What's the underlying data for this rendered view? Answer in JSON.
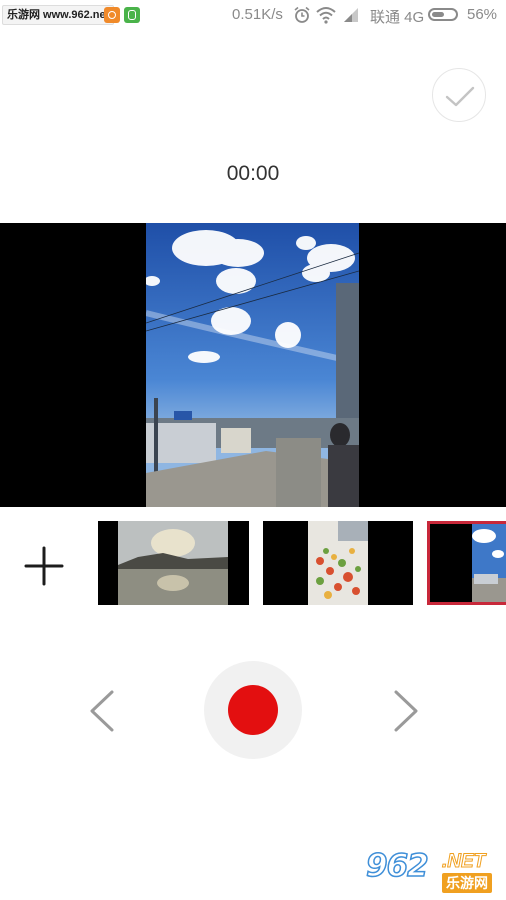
{
  "status_bar": {
    "watermark_label": "乐游网 www.962.net",
    "net_speed": "0.51K/s",
    "carrier": "联通 4G",
    "battery_percent": "56%",
    "battery_level": 0.56,
    "icons": [
      "app-notification-icon",
      "wechat-notification-icon",
      "alarm-clock-icon",
      "wifi-icon",
      "signal-icon",
      "battery-icon"
    ]
  },
  "toolbar": {
    "confirm_icon": "checkmark-icon"
  },
  "timer": "00:00",
  "preview": {
    "description_icon": "video-preview"
  },
  "clip_strip": {
    "add_icon": "plus-icon",
    "thumbnails": [
      {
        "name": "clip-thumbnail-lake",
        "selected": false
      },
      {
        "name": "clip-thumbnail-food",
        "selected": false
      },
      {
        "name": "clip-thumbnail-street",
        "selected": true
      }
    ]
  },
  "controls": {
    "prev_icon": "chevron-left-icon",
    "record_icon": "record-icon",
    "next_icon": "chevron-right-icon",
    "record_color": "#e30f10",
    "selected_border_color": "#c8283a"
  },
  "watermark": {
    "number": "962",
    "suffix": ".NET",
    "site": "乐游网"
  }
}
